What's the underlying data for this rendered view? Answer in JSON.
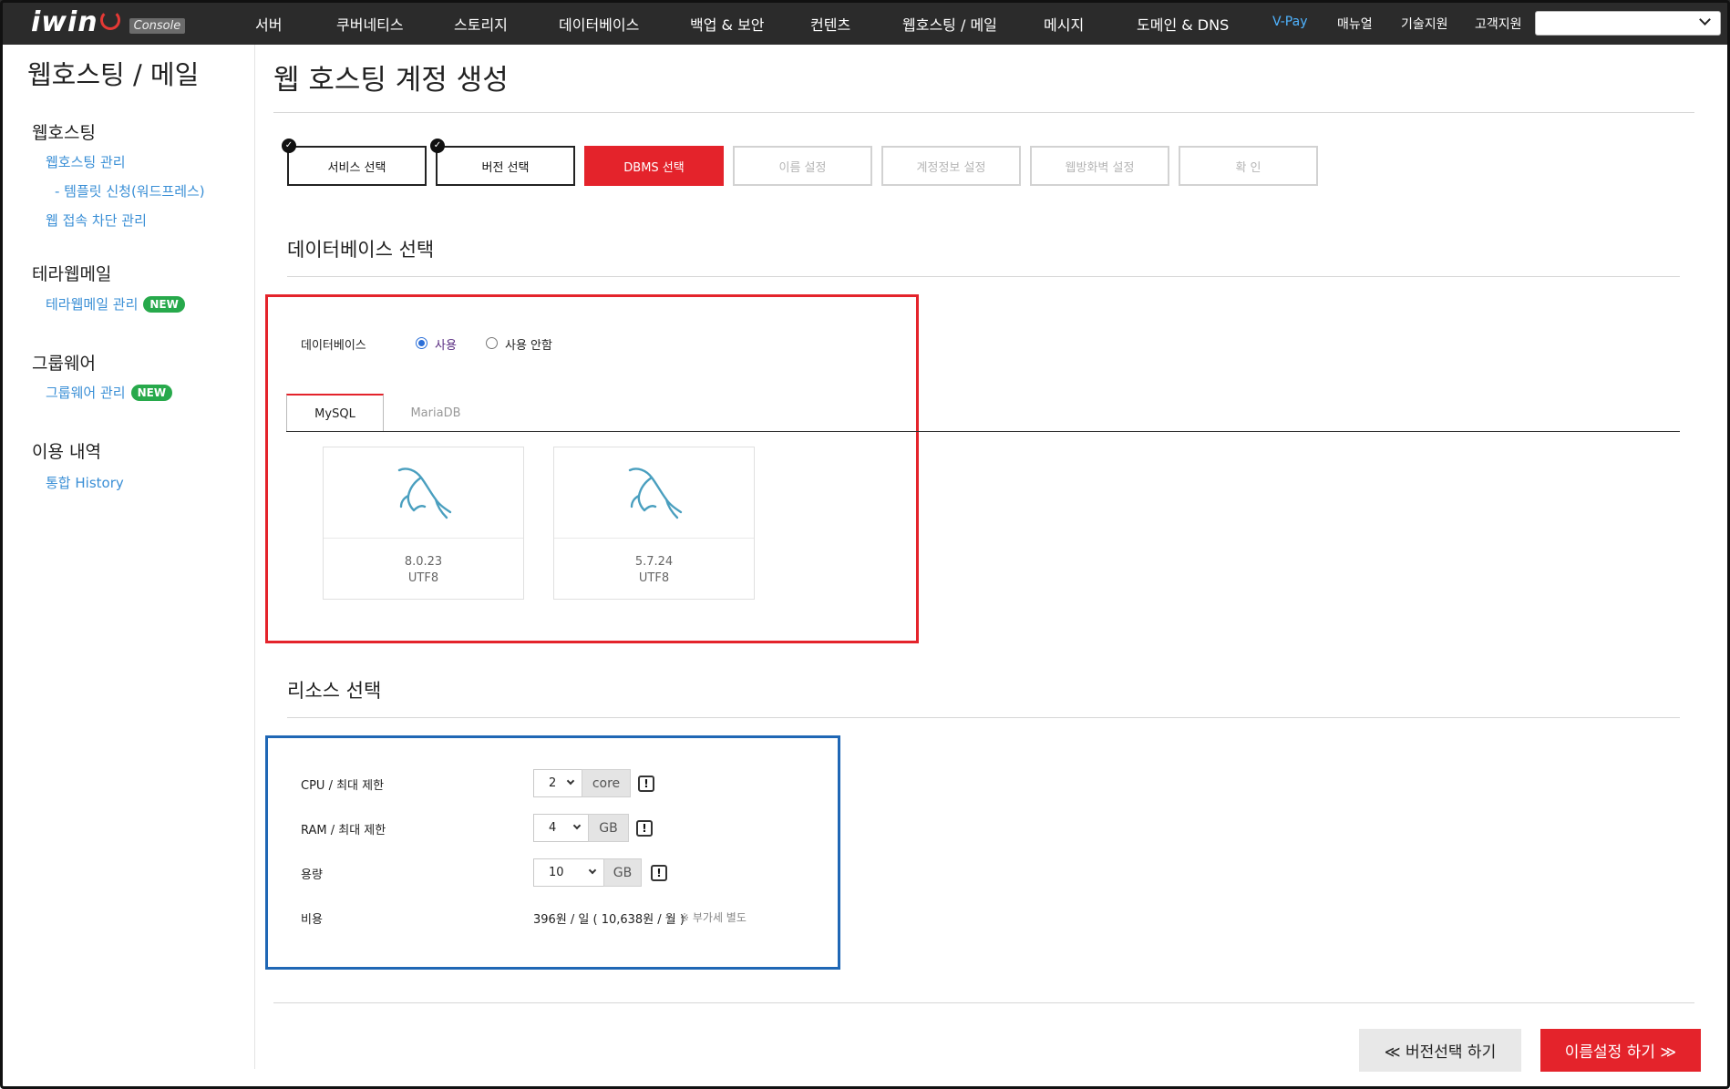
{
  "nav": {
    "logo": "iwin",
    "logo_badge": "Console",
    "items": [
      "서버",
      "쿠버네티스",
      "스토리지",
      "데이터베이스",
      "백업 & 보안",
      "컨텐츠",
      "웹호스팅 / 메일",
      "메시지",
      "도메인 & DNS"
    ],
    "utils": [
      "V-Pay",
      "매뉴얼",
      "기술지원",
      "고객지원"
    ],
    "select_value": ""
  },
  "sidebar": {
    "title": "웹호스팅 / 메일",
    "groups": [
      {
        "label": "웹호스팅",
        "links": [
          "웹호스팅 관리",
          "- 템플릿 신청(워드프레스)",
          "웹 접속 차단 관리"
        ]
      },
      {
        "label": "테라웹메일",
        "links": [
          "테라웹메일 관리"
        ],
        "badge": "NEW"
      },
      {
        "label": "그룹웨어",
        "links": [
          "그룹웨어 관리"
        ],
        "badge": "NEW"
      },
      {
        "label": "이용 내역",
        "links": [
          "통합 History"
        ]
      }
    ]
  },
  "page": {
    "title": "웹 호스팅 계정 생성"
  },
  "steps": [
    "서비스 선택",
    "버전 선택",
    "DBMS 선택",
    "이름 설정",
    "계정정보 설정",
    "웹방화벽 설정",
    "확 인"
  ],
  "db_section": {
    "title": "데이터베이스 선택",
    "label": "데이터베이스",
    "option_use": "사용",
    "option_nouse": "사용 안함",
    "tabs": [
      "MySQL",
      "MariaDB"
    ],
    "versions": [
      {
        "version": "8.0.23",
        "charset": "UTF8"
      },
      {
        "version": "5.7.24",
        "charset": "UTF8"
      }
    ]
  },
  "resource_section": {
    "title": "리소스 선택",
    "cpu_label": "CPU / 최대 제한",
    "cpu_value": "2",
    "cpu_unit": "core",
    "ram_label": "RAM / 최대 제한",
    "ram_value": "4",
    "ram_unit": "GB",
    "disk_label": "용량",
    "disk_value": "10",
    "disk_unit": "GB",
    "cost_label": "비용",
    "cost_value": "396원 / 일 ( 10,638원 / 월 )",
    "cost_note": "※ 부가세 별도"
  },
  "buttons": {
    "prev": "≪ 버전선택 하기",
    "next": "이름설정 하기 ≫"
  },
  "colors": {
    "accent_red": "#e4232b",
    "link_blue": "#3a8fd6",
    "badge_green": "#27a94b",
    "nav_bg": "#2b2b2b"
  }
}
